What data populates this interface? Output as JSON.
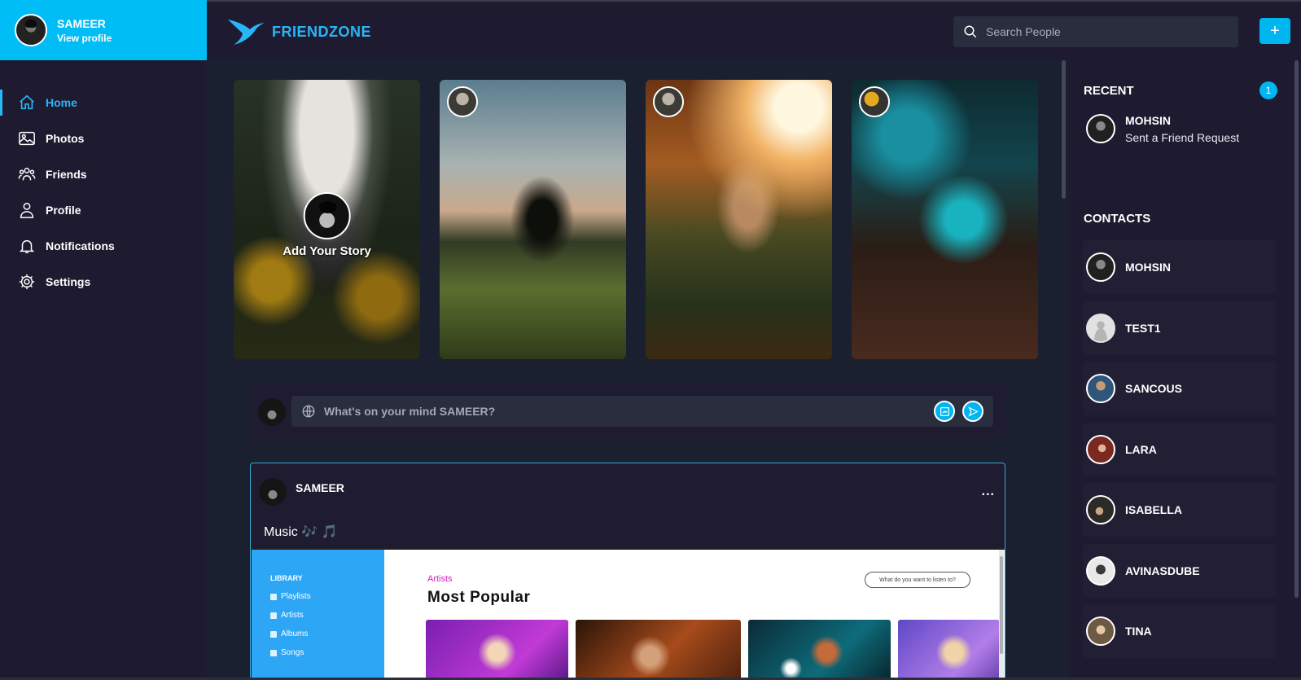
{
  "user": {
    "name": "SAMEER",
    "view_profile": "View profile"
  },
  "nav": [
    {
      "label": "Home",
      "icon": "home-icon",
      "active": true
    },
    {
      "label": "Photos",
      "icon": "photos-icon"
    },
    {
      "label": "Friends",
      "icon": "friends-icon"
    },
    {
      "label": "Profile",
      "icon": "profile-icon"
    },
    {
      "label": "Notifications",
      "icon": "bell-icon"
    },
    {
      "label": "Settings",
      "icon": "gear-icon"
    }
  ],
  "header": {
    "logo_text": "FRIENDZONE",
    "search_placeholder": "Search People",
    "add_label": "+"
  },
  "stories": {
    "add_label": "Add Your Story"
  },
  "composer": {
    "placeholder": "What's on your mind SAMEER?"
  },
  "post": {
    "author": "SAMEER",
    "more": "...",
    "caption": "Music 🎶 🎵",
    "shared_screen": {
      "library_heading": "LIBRARY",
      "library_items": [
        "Playlists",
        "Artists",
        "Albums",
        "Songs"
      ],
      "section_label": "Artists",
      "section_title": "Most Popular",
      "search_placeholder": "What do you want to listen to?"
    }
  },
  "right": {
    "recent_title": "RECENT",
    "recent_count": "1",
    "recent_item": {
      "name": "MOHSIN",
      "message": "Sent a Friend Request"
    },
    "contacts_title": "CONTACTS",
    "contacts": [
      "MOHSIN",
      "TEST1",
      "SANCOUS",
      "LARA",
      "ISABELLA",
      "AVINASDUBE",
      "TINA"
    ]
  },
  "colors": {
    "accent": "#00b6f0",
    "sidebar_bg": "#1e1b30",
    "main_bg": "#1b2030"
  }
}
